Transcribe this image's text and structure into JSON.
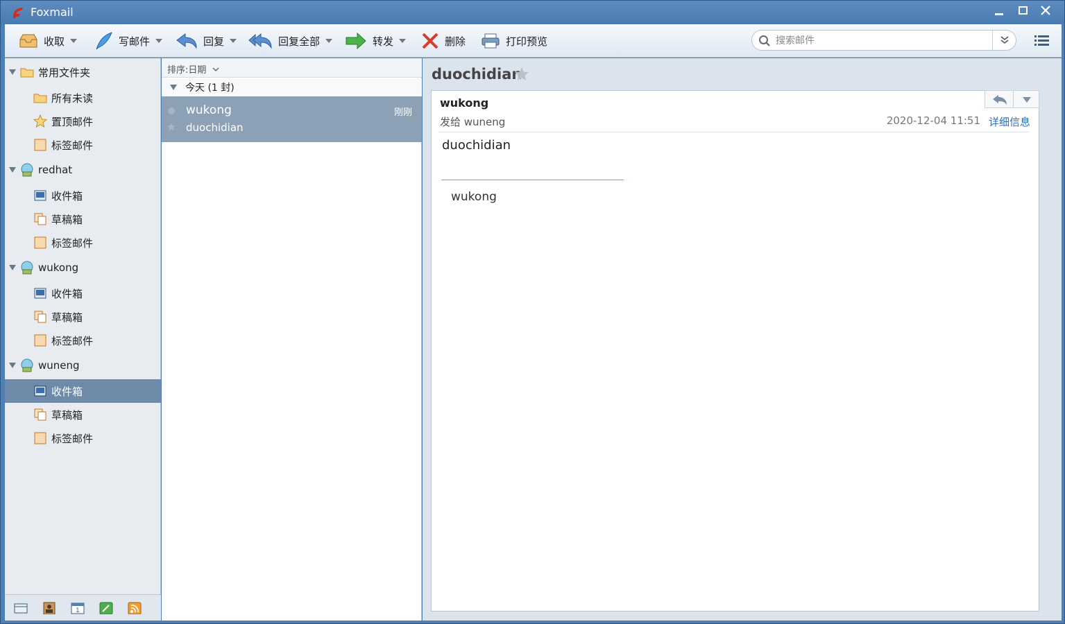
{
  "window": {
    "title": "Foxmail"
  },
  "toolbar": {
    "receive": "收取",
    "compose": "写邮件",
    "reply": "回复",
    "reply_all": "回复全部",
    "forward": "转发",
    "delete": "删除",
    "print_preview": "打印预览"
  },
  "search": {
    "placeholder": "搜索邮件"
  },
  "sidebar": {
    "favorites": {
      "label": "常用文件夹",
      "items": [
        "所有未读",
        "置顶邮件",
        "标签邮件"
      ]
    },
    "accounts": [
      {
        "name": "redhat",
        "folders": [
          "收件箱",
          "草稿箱",
          "标签邮件"
        ]
      },
      {
        "name": "wukong",
        "folders": [
          "收件箱",
          "草稿箱",
          "标签邮件"
        ]
      },
      {
        "name": "wuneng",
        "folders": [
          "收件箱",
          "草稿箱",
          "标签邮件"
        ]
      }
    ],
    "selected": "wuneng/收件箱"
  },
  "list": {
    "sort_label": "排序:日期",
    "group_label": "今天 (1 封)",
    "items": [
      {
        "sender": "wukong",
        "subject": "duochidian",
        "time": "刚刚"
      }
    ]
  },
  "reader": {
    "subject": "duochidian",
    "sender": "wukong",
    "to": "发给 wuneng",
    "date": "2020-12-04 11:51",
    "detail_link": "详细信息",
    "body": "duochidian",
    "signature": "wukong"
  },
  "colors": {
    "accent": "#4a7bb0",
    "selection": "#6e8aa8",
    "link": "#2a6fc1"
  }
}
